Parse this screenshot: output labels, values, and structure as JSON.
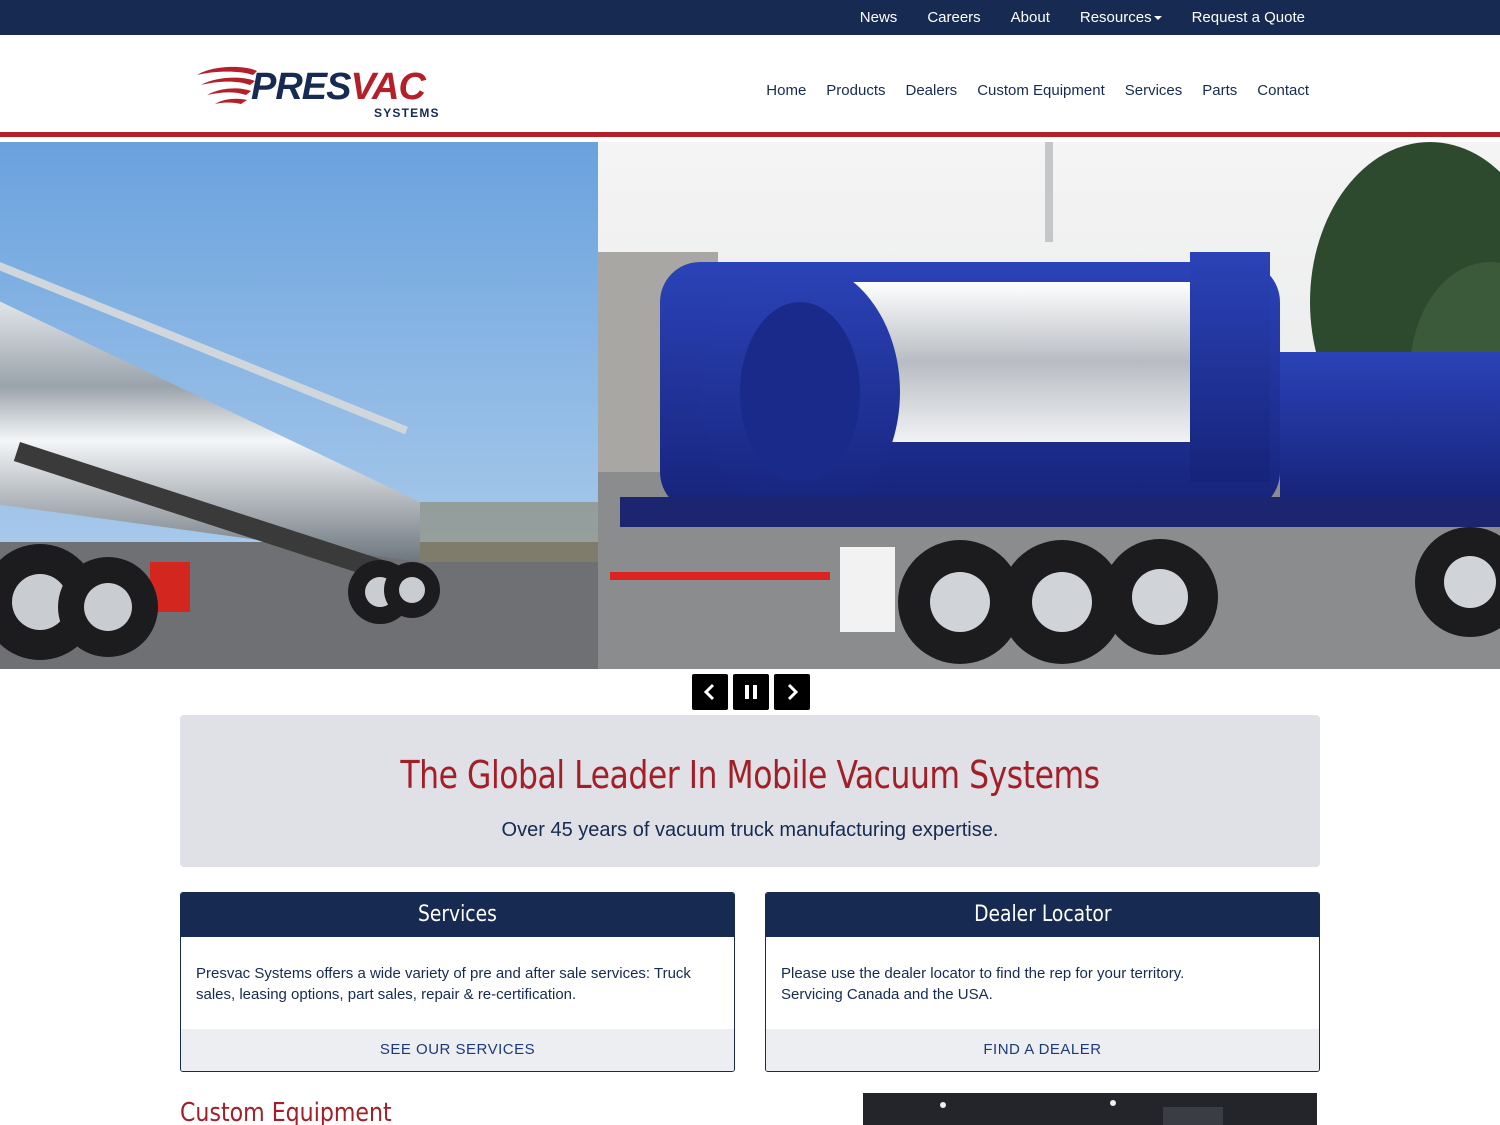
{
  "topbar": {
    "links": [
      {
        "label": "News"
      },
      {
        "label": "Careers"
      },
      {
        "label": "About"
      },
      {
        "label": "Resources",
        "icon": "caret-down-icon"
      },
      {
        "label": "Request a Quote"
      }
    ]
  },
  "header": {
    "logo": {
      "word1": "PRES",
      "word2": "VAC",
      "tagline": "SYSTEMS"
    },
    "nav": [
      "Home",
      "Products",
      "Dealers",
      "Custom Equipment",
      "Services",
      "Parts",
      "Contact"
    ]
  },
  "slider": {
    "controls": [
      {
        "icon": "chevron-left-icon"
      },
      {
        "icon": "pause-icon"
      },
      {
        "icon": "chevron-right-icon"
      }
    ]
  },
  "hero_panel": {
    "title": "The Global Leader In Mobile Vacuum Systems",
    "subtitle": "Over 45 years of vacuum truck manufacturing expertise."
  },
  "cards": [
    {
      "title": "Services",
      "body": "Presvac Systems offers a wide variety of pre and after sale services: Truck sales, leasing options, part sales, repair & re-certification.",
      "cta": "SEE OUR SERVICES"
    },
    {
      "title": "Dealer Locator",
      "body_line1": "Please use the dealer locator to find the rep for your territory.",
      "body_line2": "Servicing Canada and the USA.",
      "cta": "FIND A DEALER"
    }
  ],
  "section": {
    "custom_heading": "Custom Equipment"
  },
  "colors": {
    "navy": "#172a52",
    "red": "#a31f27",
    "panel": "#dfe1e6"
  }
}
